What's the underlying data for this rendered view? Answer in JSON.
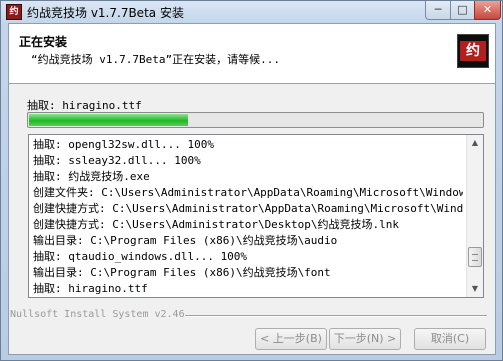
{
  "window": {
    "title": "约战竞技场 v1.7.7Beta 安装",
    "controls": {
      "minimize": "─",
      "maximize": "□",
      "close": "✕"
    }
  },
  "header": {
    "title": "正在安装",
    "subtitle": "“约战竞技场 v1.7.7Beta”正在安装，请等候...",
    "logo_glyph": "约"
  },
  "status": {
    "current_action": "抽取: hiragino.ttf",
    "progress_fraction": 0.35
  },
  "log": {
    "lines": [
      "抽取: opengl32sw.dll... 100%",
      "抽取: ssleay32.dll... 100%",
      "抽取: 约战竞技场.exe",
      "创建文件夹: C:\\Users\\Administrator\\AppData\\Roaming\\Microsoft\\Window...",
      "创建快捷方式: C:\\Users\\Administrator\\AppData\\Roaming\\Microsoft\\Wind...",
      "创建快捷方式: C:\\Users\\Administrator\\Desktop\\约战竞技场.lnk",
      "输出目录: C:\\Program Files (x86)\\约战竞技场\\audio",
      "抽取: qtaudio_windows.dll... 100%",
      "输出目录: C:\\Program Files (x86)\\约战竞技场\\font",
      "抽取: hiragino.ttf"
    ]
  },
  "footer": {
    "brand": "Nullsoft Install System v2.46",
    "back_label": "< 上一步(B)",
    "next_label": "下一步(N) >",
    "cancel_label": "取消(C)"
  },
  "colors": {
    "progress": "#22b822",
    "title_bar": "#c4d6ea",
    "logo_red": "#b11f1f"
  }
}
